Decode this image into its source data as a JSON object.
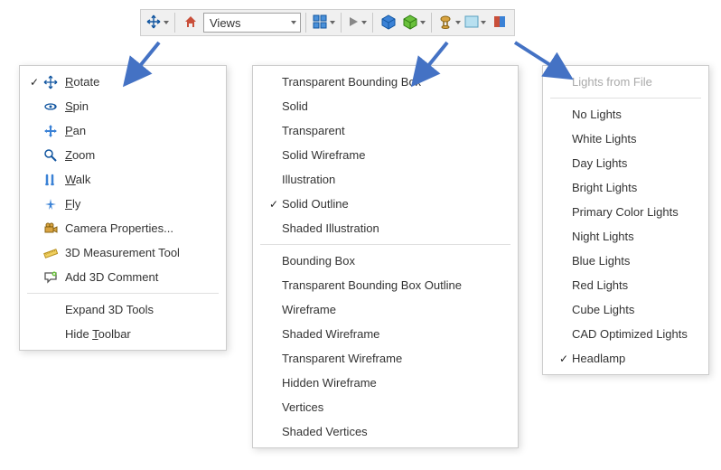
{
  "toolbar": {
    "views_value": "Views"
  },
  "nav_menu": {
    "items": [
      {
        "checked": true,
        "icon": "rotate",
        "label": "Rotate",
        "ul": "R"
      },
      {
        "checked": false,
        "icon": "spin",
        "label": "Spin",
        "ul": "S"
      },
      {
        "checked": false,
        "icon": "pan",
        "label": "Pan",
        "ul": "P"
      },
      {
        "checked": false,
        "icon": "zoom",
        "label": "Zoom",
        "ul": "Z"
      },
      {
        "checked": false,
        "icon": "walk",
        "label": "Walk",
        "ul": "W"
      },
      {
        "checked": false,
        "icon": "fly",
        "label": "Fly",
        "ul": "F"
      },
      {
        "checked": false,
        "icon": "camera",
        "label": "Camera Properties...",
        "ul": ""
      },
      {
        "checked": false,
        "icon": "measure",
        "label": "3D Measurement Tool",
        "ul": ""
      },
      {
        "checked": false,
        "icon": "comment",
        "label": "Add 3D Comment",
        "ul": ""
      }
    ],
    "tail": [
      {
        "label": "Expand 3D Tools",
        "ul": ""
      },
      {
        "label": "Hide Toolbar",
        "ul": "T",
        "ul_text": "Toolbar"
      }
    ]
  },
  "render_menu": {
    "group1": [
      {
        "checked": false,
        "label": "Transparent Bounding Box"
      },
      {
        "checked": false,
        "label": "Solid"
      },
      {
        "checked": false,
        "label": "Transparent"
      },
      {
        "checked": false,
        "label": "Solid Wireframe"
      },
      {
        "checked": false,
        "label": "Illustration"
      },
      {
        "checked": true,
        "label": "Solid Outline"
      },
      {
        "checked": false,
        "label": "Shaded Illustration"
      }
    ],
    "group2": [
      {
        "checked": false,
        "label": "Bounding Box"
      },
      {
        "checked": false,
        "label": "Transparent Bounding Box Outline"
      },
      {
        "checked": false,
        "label": "Wireframe"
      },
      {
        "checked": false,
        "label": "Shaded Wireframe"
      },
      {
        "checked": false,
        "label": "Transparent Wireframe"
      },
      {
        "checked": false,
        "label": "Hidden Wireframe"
      },
      {
        "checked": false,
        "label": "Vertices"
      },
      {
        "checked": false,
        "label": "Shaded Vertices"
      }
    ]
  },
  "lights_menu": {
    "header": {
      "label": "Lights from File",
      "disabled": true
    },
    "items": [
      {
        "checked": false,
        "label": "No Lights"
      },
      {
        "checked": false,
        "label": "White Lights"
      },
      {
        "checked": false,
        "label": "Day Lights"
      },
      {
        "checked": false,
        "label": "Bright Lights"
      },
      {
        "checked": false,
        "label": "Primary Color Lights"
      },
      {
        "checked": false,
        "label": "Night Lights"
      },
      {
        "checked": false,
        "label": "Blue Lights"
      },
      {
        "checked": false,
        "label": "Red Lights"
      },
      {
        "checked": false,
        "label": "Cube Lights"
      },
      {
        "checked": false,
        "label": "CAD Optimized Lights"
      },
      {
        "checked": true,
        "label": "Headlamp"
      }
    ]
  },
  "arrow_color": "#4472C4"
}
